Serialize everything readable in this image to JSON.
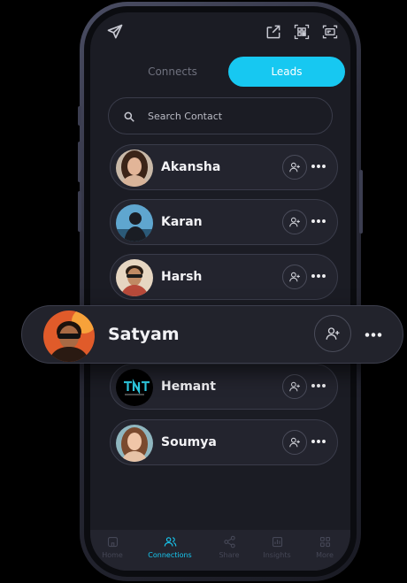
{
  "tabs": {
    "connects": "Connects",
    "leads": "Leads"
  },
  "search": {
    "placeholder": "Search Contact"
  },
  "contacts": [
    {
      "name": "Akansha"
    },
    {
      "name": "Karan"
    },
    {
      "name": "Harsh"
    },
    {
      "name": "Satyam"
    },
    {
      "name": "Hemant"
    },
    {
      "name": "Soumya"
    }
  ],
  "nav": [
    {
      "label": "Home",
      "icon": "home-icon"
    },
    {
      "label": "Connections",
      "icon": "connections-icon"
    },
    {
      "label": "Share",
      "icon": "share-icon"
    },
    {
      "label": "Insights",
      "icon": "insights-icon"
    },
    {
      "label": "More",
      "icon": "grid-icon"
    }
  ],
  "colors": {
    "accent": "#17c8f1",
    "background": "#1b1c24",
    "card": "#23242e"
  }
}
